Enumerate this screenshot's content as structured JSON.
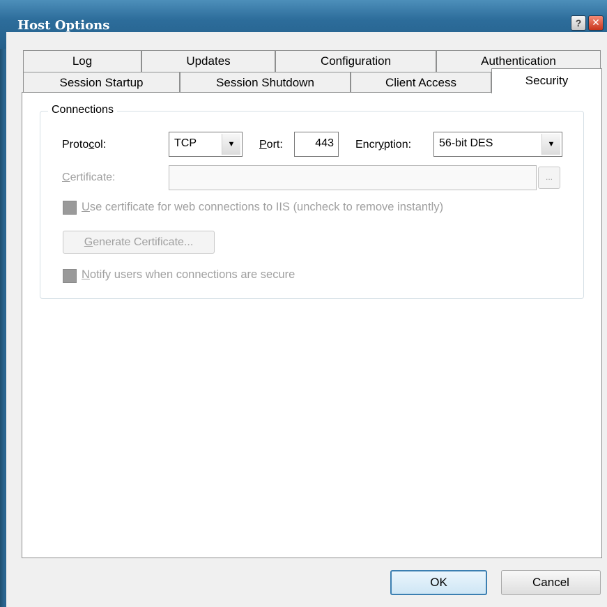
{
  "window": {
    "title": "Host Options",
    "help_glyph": "?",
    "close_glyph": "✕"
  },
  "tabs": {
    "row_top": [
      {
        "label": "Log"
      },
      {
        "label": "Updates"
      },
      {
        "label": "Configuration"
      },
      {
        "label": "Authentication"
      }
    ],
    "row_bottom": [
      {
        "label": "Session Startup"
      },
      {
        "label": "Session Shutdown"
      },
      {
        "label": "Client Access"
      },
      {
        "label": "Security",
        "active": true
      }
    ]
  },
  "connections": {
    "group_title": "Connections",
    "protocol": {
      "label_pre": "Proto",
      "label_u": "c",
      "label_post": "ol:",
      "value": "TCP"
    },
    "port": {
      "label_u": "P",
      "label_post": "ort:",
      "value": "443"
    },
    "encryption": {
      "label_pre": "Encr",
      "label_u": "y",
      "label_post": "ption:",
      "value": "56-bit DES"
    },
    "certificate": {
      "label_u": "C",
      "label_post": "ertificate:",
      "value": "",
      "browse_label": "..."
    },
    "use_cert": {
      "label_u": "U",
      "label_post": "se certificate for web connections to IIS (uncheck to remove instantly)"
    },
    "generate": {
      "label_u": "G",
      "label_post": "enerate Certificate..."
    },
    "notify": {
      "label_u": "N",
      "label_post": "otify users when connections are secure"
    }
  },
  "footer": {
    "ok_label": "OK",
    "cancel_label": "Cancel"
  },
  "colors": {
    "title_bar": "#2d6d9b",
    "client_bg": "#f0f0f0",
    "close_red": "#c8341c"
  }
}
